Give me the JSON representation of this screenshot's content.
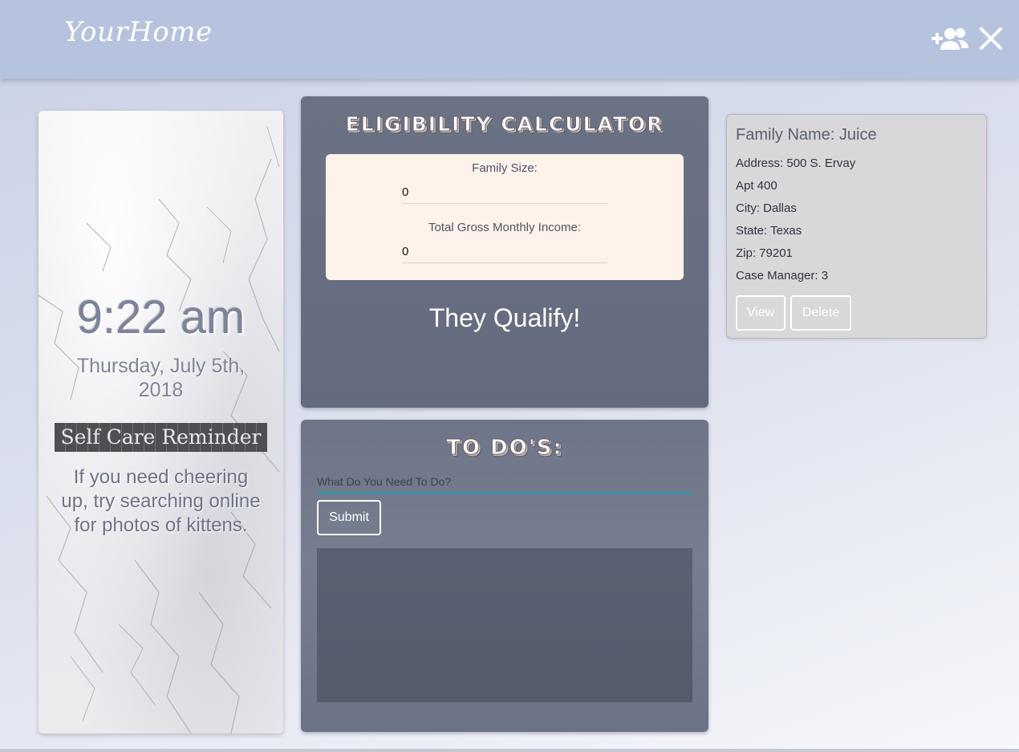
{
  "header": {
    "brand": "YourHome",
    "icons": [
      "add-user-icon",
      "close-icon"
    ]
  },
  "clock": {
    "time": "9:22 am",
    "date": "Thursday, July 5th, 2018",
    "reminder_title": "Self Care Reminder",
    "reminder_text": "If you need cheering up, try searching online for photos of kittens."
  },
  "calculator": {
    "title": "ELIGIBILITY CALCULATOR",
    "family_size_label": "Family Size:",
    "family_size_value": "0",
    "income_label": "Total Gross Monthly Income:",
    "income_value": "0",
    "result": "They Qualify!"
  },
  "todos": {
    "title": "TO DO'S:",
    "placeholder": "What Do You Need To Do?",
    "submit_label": "Submit",
    "items": []
  },
  "family": {
    "name_line": "Family Name: Juice",
    "address": "Address: 500 S. Ervay",
    "apt": "Apt 400",
    "city": "City: Dallas",
    "state": "State: Texas",
    "zip": "Zip: 79201",
    "case_manager": "Case Manager: 3",
    "view_label": "View",
    "delete_label": "Delete"
  },
  "colors": {
    "header_bg": "#b6c3de",
    "panel_bg": "#6b7285",
    "form_bg": "#fff2ea",
    "todo_underline": "#1ea0b4",
    "card_bg": "#d8d8da"
  }
}
